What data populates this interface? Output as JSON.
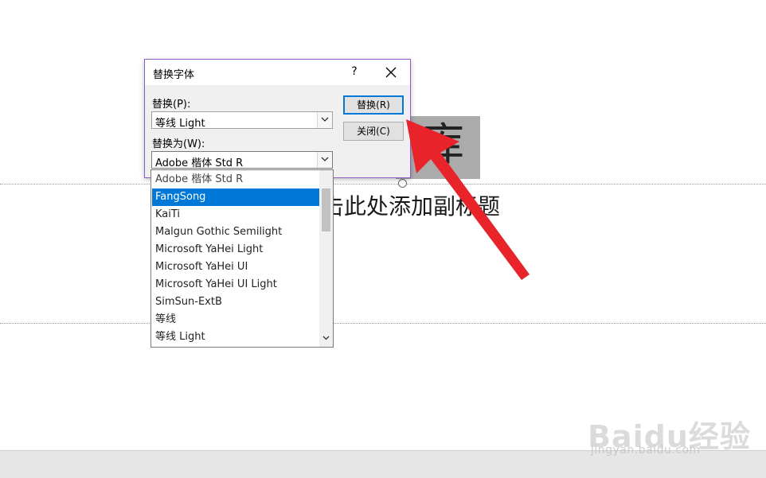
{
  "slide": {
    "title_glyph": "库",
    "subtitle": "击此处添加副标题"
  },
  "dialog": {
    "title": "替换字体",
    "help_label": "?",
    "replace_label": "替换(P):",
    "replace_value": "等线 Light",
    "replace_with_label": "替换为(W):",
    "replace_with_value": "Adobe 楷体 Std R",
    "replace_button": "替换(R)",
    "close_button": "关闭(C)"
  },
  "dropdown": {
    "items": [
      "Adobe 楷体 Std R",
      "FangSong",
      "KaiTi",
      "Malgun Gothic Semilight",
      "Microsoft YaHei Light",
      "Microsoft YaHei UI",
      "Microsoft YaHei UI Light",
      "SimSun-ExtB",
      "等线",
      "等线 Light"
    ],
    "selected_index": 1
  },
  "watermark": {
    "brand": "Bai",
    "brand_tail": "du",
    "suffix": "经验",
    "url": "jingyan.baidu.com"
  },
  "colors": {
    "accent": "#0078d7",
    "dialog_border": "#8b5cc6",
    "arrow": "#e8232a"
  },
  "icons": {
    "close": "close-icon",
    "dropdown": "chevron-down-icon"
  }
}
